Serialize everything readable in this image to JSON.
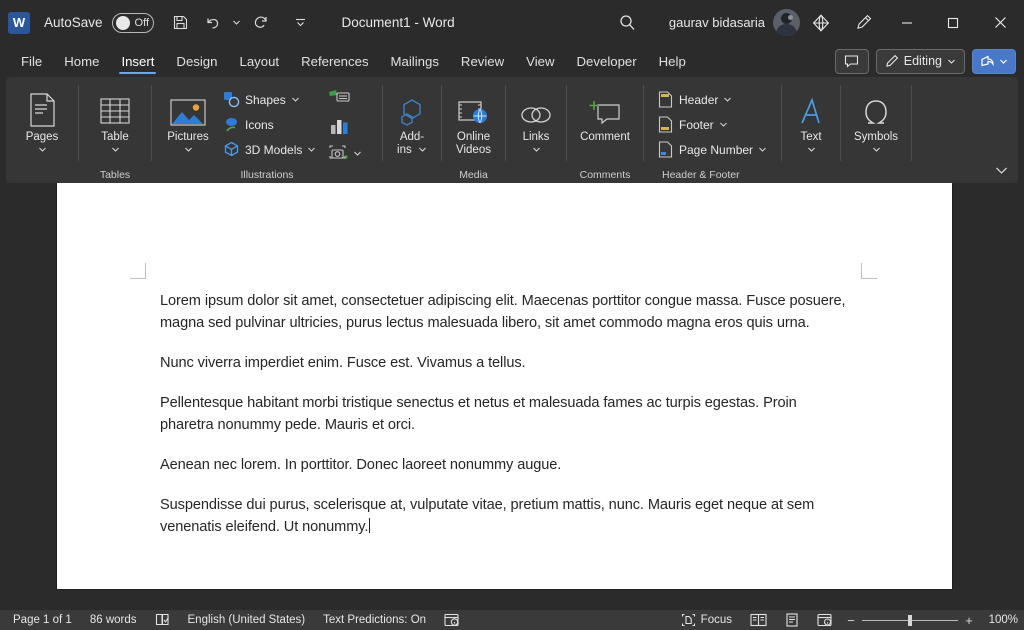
{
  "titlebar": {
    "logo_text": "W",
    "autosave_label": "AutoSave",
    "autosave_state": "Off",
    "save_icon": "save-icon",
    "undo_icon": "undo-icon",
    "redo_icon": "redo-icon",
    "customize_icon": "customize-quick-access-icon",
    "document_title": "Document1  -  Word",
    "search_icon": "search-icon",
    "user_name": "gaurav bidasaria",
    "copilot_icon": "copilot-diamond-icon",
    "pen_icon": "pen-highlighter-icon",
    "minimize": "–",
    "maximize": "▭",
    "close": "✕"
  },
  "tabs": [
    {
      "label": "File",
      "active": false
    },
    {
      "label": "Home",
      "active": false
    },
    {
      "label": "Insert",
      "active": true
    },
    {
      "label": "Design",
      "active": false
    },
    {
      "label": "Layout",
      "active": false
    },
    {
      "label": "References",
      "active": false
    },
    {
      "label": "Mailings",
      "active": false
    },
    {
      "label": "Review",
      "active": false
    },
    {
      "label": "View",
      "active": false
    },
    {
      "label": "Developer",
      "active": false
    },
    {
      "label": "Help",
      "active": false
    }
  ],
  "tabstrip_right": {
    "comment_label": "",
    "editing_label": "Editing",
    "share_label": ""
  },
  "ribbon": {
    "groups": [
      {
        "label": "",
        "name": "pages-group"
      },
      {
        "label": "Tables",
        "name": "tables-group"
      },
      {
        "label": "Illustrations",
        "name": "illustrations-group"
      },
      {
        "label": "",
        "name": "addins-group"
      },
      {
        "label": "Media",
        "name": "media-group"
      },
      {
        "label": "Comments",
        "name": "comments-group"
      },
      {
        "label": "Header & Footer",
        "name": "header-footer-group"
      },
      {
        "label": "",
        "name": "text-group"
      },
      {
        "label": "",
        "name": "symbols-group"
      }
    ],
    "pages_label": "Pages",
    "table_label": "Table",
    "pictures_label": "Pictures",
    "shapes_label": "Shapes",
    "icons_label": "Icons",
    "models_label": "3D Models",
    "smartart_icon": "smartart-icon",
    "chart_icon": "chart-icon",
    "screenshot_icon": "screenshot-icon",
    "addins_label": "Add-\nins",
    "addins_label_1": "Add-",
    "addins_label_2": "ins",
    "online_videos_label_1": "Online",
    "online_videos_label_2": "Videos",
    "links_label": "Links",
    "comment_label": "Comment",
    "header_label": "Header",
    "footer_label": "Footer",
    "page_number_label": "Page Number",
    "text_label": "Text",
    "symbols_label": "Symbols",
    "collapse_icon": "collapse-ribbon-icon"
  },
  "document": {
    "paragraphs": [
      "Lorem ipsum dolor sit amet, consectetuer adipiscing elit. Maecenas porttitor congue massa. Fusce posuere, magna sed pulvinar ultricies, purus lectus malesuada libero, sit amet commodo magna eros quis urna.",
      "Nunc viverra imperdiet enim. Fusce est. Vivamus a tellus.",
      "Pellentesque habitant morbi tristique senectus et netus et malesuada fames ac turpis egestas. Proin pharetra nonummy pede. Mauris et orci.",
      "Aenean nec lorem. In porttitor. Donec laoreet nonummy augue.",
      "Suspendisse dui purus, scelerisque at, vulputate vitae, pretium mattis, nunc. Mauris eget neque at sem venenatis eleifend. Ut nonummy."
    ]
  },
  "statusbar": {
    "page_info": "Page 1 of 1",
    "word_count": "86 words",
    "proofing_icon": "proofing-errors-icon",
    "language": "English (United States)",
    "text_predictions": "Text Predictions: On",
    "accessibility_icon": "accessibility-checker-icon",
    "focus_label": "Focus",
    "read_mode_icon": "read-mode-icon",
    "print_layout_icon": "print-layout-icon",
    "web_layout_icon": "web-layout-icon",
    "zoom_out": "−",
    "zoom_in": "+",
    "zoom_level": "100%"
  },
  "colors": {
    "window_bg": "#2b2b2b",
    "ribbon_bg": "#363636",
    "statusbar_bg": "#3a3a3a",
    "accent_blue": "#6ea8e8",
    "share_blue": "#4a78c8",
    "word_brand": "#2b579a",
    "page_white": "#ffffff"
  }
}
